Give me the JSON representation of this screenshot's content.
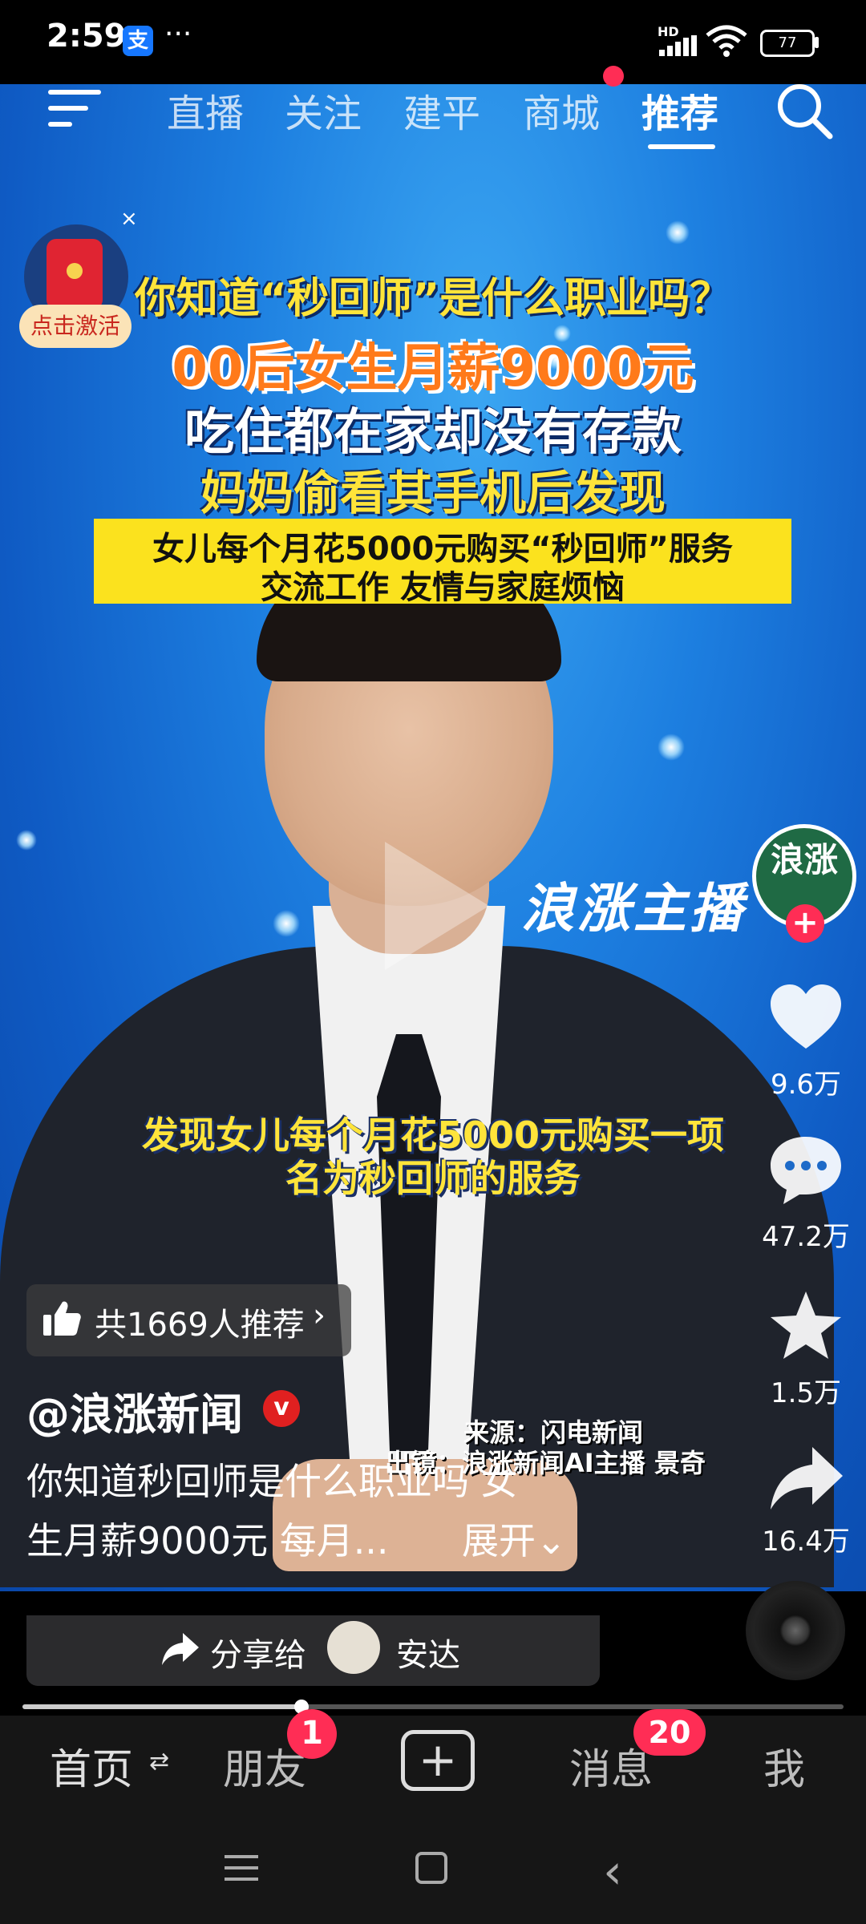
{
  "status_bar": {
    "time": "2:59",
    "app_icon_glyph": "支",
    "more": "···",
    "network": "HD",
    "battery": "77"
  },
  "top_nav": {
    "tabs": [
      {
        "label": "直播"
      },
      {
        "label": "关注"
      },
      {
        "label": "建平"
      },
      {
        "label": "商城"
      },
      {
        "label": "推荐",
        "active": true
      }
    ],
    "icons": [
      "menu-icon",
      "search-icon"
    ]
  },
  "red_packet": {
    "label": "点击激活",
    "close": "×"
  },
  "video": {
    "headlines": [
      "你知道“秒回师”是什么职业吗？",
      "00后女生月薪9000元",
      "吃住都在家却没有存款",
      "妈妈偷看其手机后发现"
    ],
    "yellow_box": [
      "女儿每个月花5000元购买“秒回师”服务",
      "交流工作 友情与家庭烦恼"
    ],
    "watermark": "浪涨主播",
    "subtitle": [
      "发现女儿每个月花5000元购买一项",
      "名为秒回师的服务"
    ],
    "source_line1": "来源：闪电新闻",
    "source_line2": "出镜：浪涨新闻AI主播 景奇"
  },
  "side_actions": {
    "avatar_text": "浪涨",
    "follow_plus": "+",
    "likes": "9.6万",
    "comments": "47.2万",
    "favorites": "1.5万",
    "shares": "16.4万"
  },
  "recommend": {
    "text": "共1669人推荐",
    "arrow": "›"
  },
  "post": {
    "author": "@浪涨新闻",
    "verified": "v",
    "description_line1": "你知道秒回师是什么职业吗 女",
    "description_line2": "生月薪9000元 每月...",
    "expand": "展开⌄"
  },
  "share_bar": {
    "label": "分享给",
    "name": "安达"
  },
  "playback": {
    "progress": 0.34
  },
  "bottom_nav": {
    "home": "首页",
    "home_arrows": "⇄",
    "friends": "朋友",
    "friends_badge": "1",
    "post_plus": "+",
    "messages": "消息",
    "messages_badge": "20",
    "me": "我"
  },
  "system_nav": {
    "back": "‹"
  },
  "colors": {
    "accent_red": "#ff2d55",
    "headline_yellow": "#ffe43a",
    "headline_orange": "#ff7a1a"
  }
}
